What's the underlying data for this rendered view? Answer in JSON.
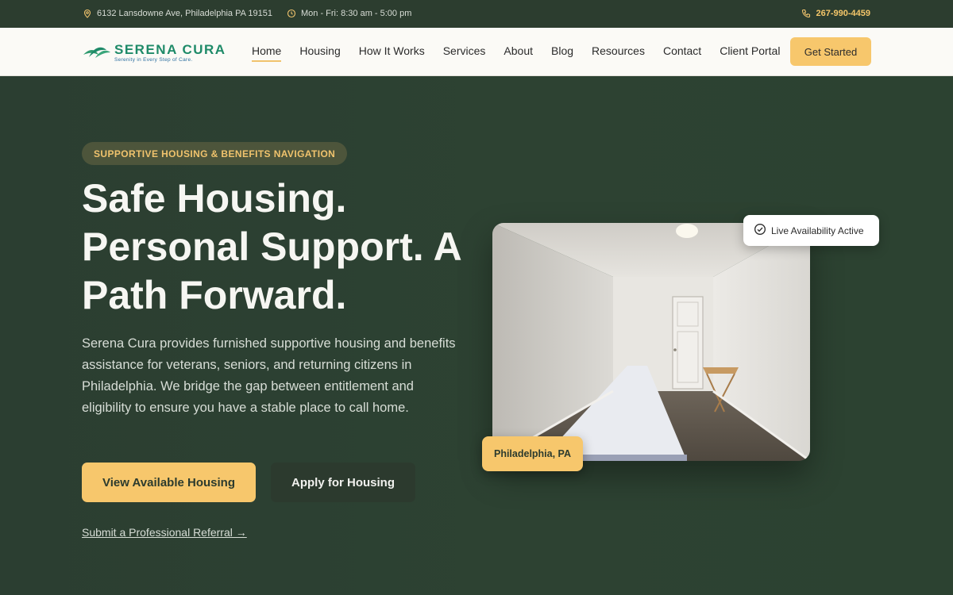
{
  "topbar": {
    "address": "6132 Lansdowne Ave, Philadelphia PA 19151",
    "hours": "Mon - Fri: 8:30 am - 5:00 pm",
    "phone": "267-990-4459"
  },
  "brand": {
    "name": "SERENA CURA",
    "tagline": "Serenity in Every Step of Care."
  },
  "nav": {
    "items": [
      {
        "label": "Home",
        "active": true
      },
      {
        "label": "Housing"
      },
      {
        "label": "How It Works"
      },
      {
        "label": "Services"
      },
      {
        "label": "About"
      },
      {
        "label": "Blog"
      },
      {
        "label": "Resources"
      },
      {
        "label": "Contact"
      },
      {
        "label": "Client Portal"
      }
    ],
    "cta_label": "Get Started"
  },
  "hero": {
    "eyebrow": "SUPPORTIVE HOUSING & BENEFITS NAVIGATION",
    "headline_line1": "Safe Housing.",
    "headline_line2": "Personal Support. A",
    "headline_line3": "Path Forward.",
    "lead": "Serena Cura provides furnished supportive housing and benefits assistance for veterans, seniors, and returning citizens in Philadelphia. We bridge the gap between entitlement and eligibility to ensure you have a stable place to call home.",
    "primary_button": "View Available Housing",
    "secondary_button": "Apply for Housing",
    "referral_link": "Submit a Professional Referral →",
    "availability_badge": "Live Availability Active",
    "location_badge": "Philadelphia, PA"
  },
  "colors": {
    "accent": "#f7c76c",
    "brand_green": "#1e8a68",
    "hero_bg": "#2b3e31"
  }
}
